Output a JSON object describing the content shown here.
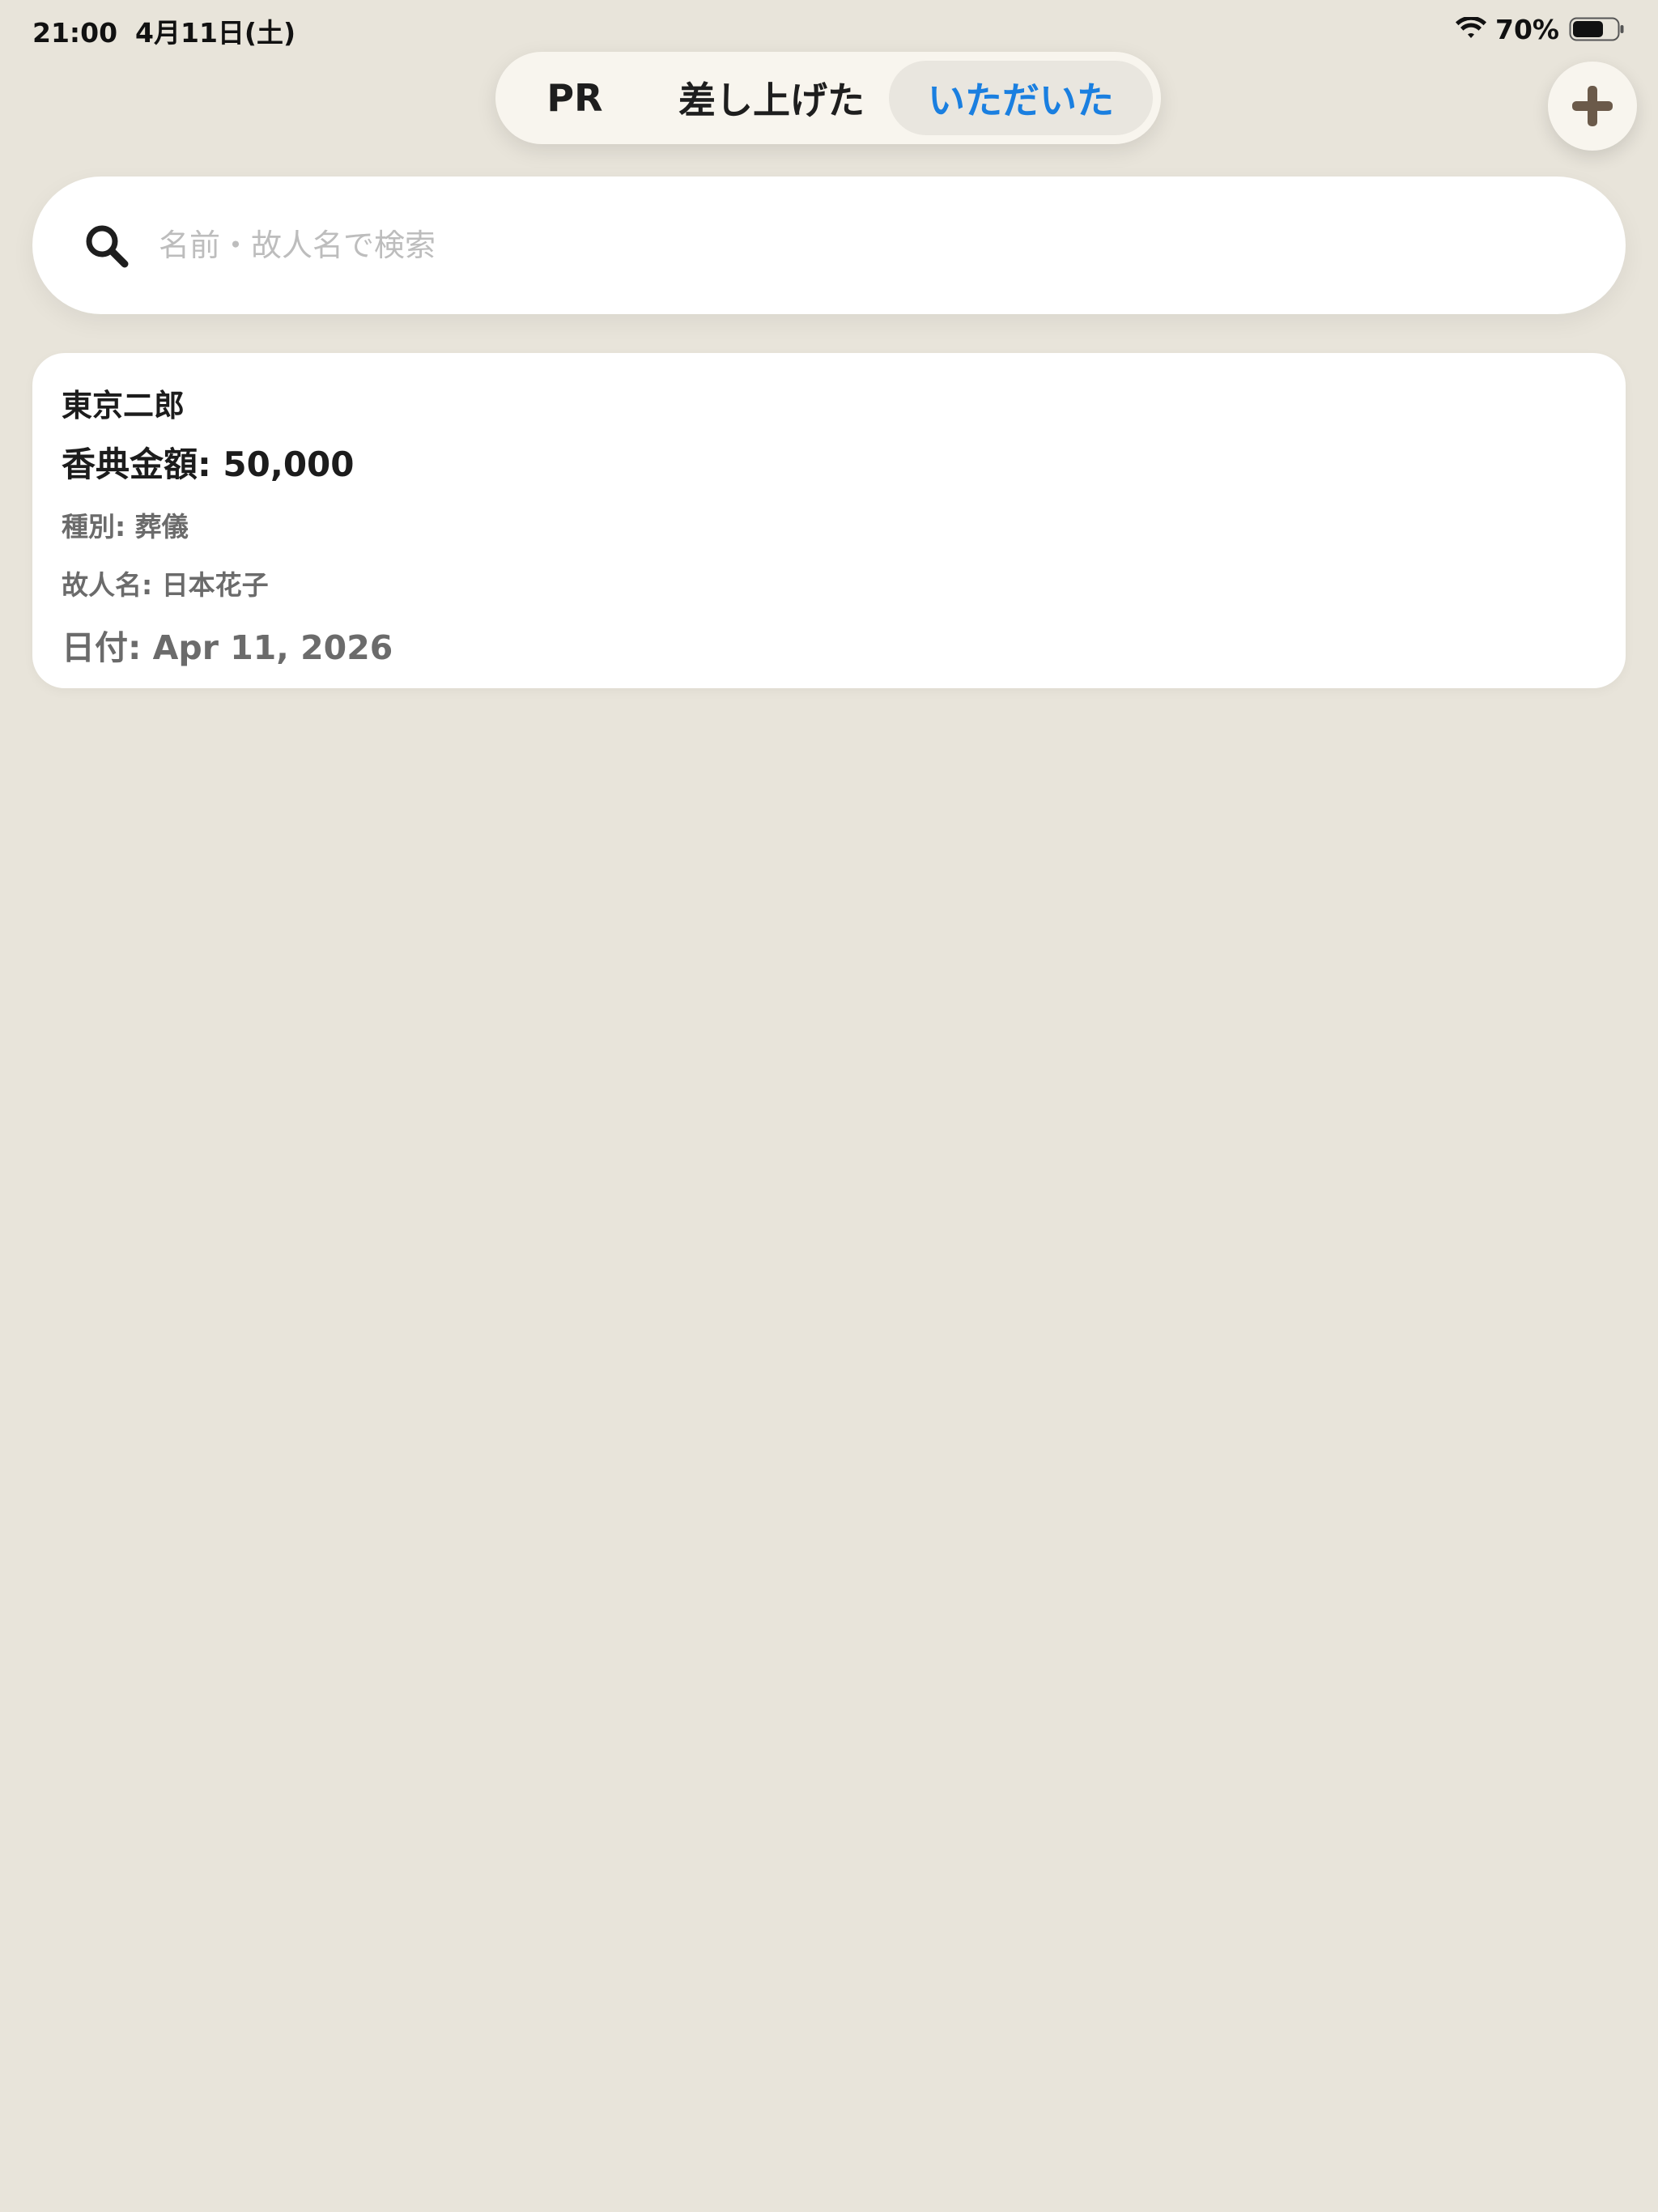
{
  "status_bar": {
    "time": "21:00",
    "date": "4月11日(土)",
    "battery_percent": "70%",
    "battery_level": 0.7,
    "wifi_icon": "wifi-icon",
    "battery_icon": "battery-icon"
  },
  "segments": {
    "items": [
      {
        "label": "PR"
      },
      {
        "label": "差し上げた"
      },
      {
        "label": "いただいた"
      }
    ],
    "selected": "いただいた",
    "selected_color": "#1a7fe0"
  },
  "add_button": {
    "icon": "plus-icon",
    "icon_color": "#6b5a4a"
  },
  "search": {
    "icon": "search-icon",
    "placeholder": "名前・故人名で検索",
    "value": ""
  },
  "records": [
    {
      "name": "東京二郎",
      "amount_label": "香典金額: 50,000",
      "type_label": "種別: 葬儀",
      "deceased_label": "故人名: 日本花子",
      "date_label": "日付: Apr 11, 2026"
    }
  ],
  "colors": {
    "background": "#e8e4da",
    "card": "#ffffff",
    "accent": "#1a7fe0"
  }
}
